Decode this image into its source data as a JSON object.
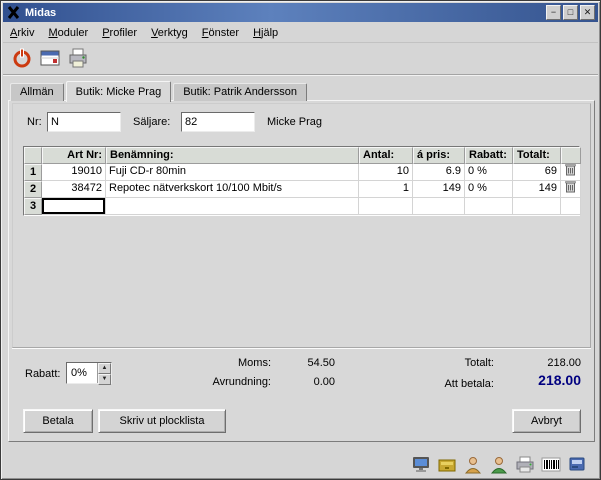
{
  "window": {
    "title": "Midas",
    "controls": {
      "minimize": "−",
      "maximize": "□",
      "close": "✕"
    }
  },
  "menubar": {
    "items": [
      {
        "label": "Arkiv"
      },
      {
        "label": "Moduler"
      },
      {
        "label": "Profiler"
      },
      {
        "label": "Verktyg"
      },
      {
        "label": "Fönster"
      },
      {
        "label": "Hjälp"
      }
    ]
  },
  "toolbar": {
    "buttons": [
      {
        "icon": "power-icon"
      },
      {
        "icon": "new-sale-window-icon"
      },
      {
        "icon": "printer-icon"
      }
    ]
  },
  "tabs": [
    {
      "label": "Allmän",
      "active": false
    },
    {
      "label": "Butik: Micke Prag",
      "active": true
    },
    {
      "label": "Butik: Patrik Andersson",
      "active": false
    }
  ],
  "form": {
    "nr_label": "Nr:",
    "nr_value": "N",
    "saljare_label": "Säljare:",
    "saljare_value": "82",
    "seller_name": "Micke Prag"
  },
  "table": {
    "headers": [
      "Art Nr:",
      "Benämning:",
      "Antal:",
      "á pris:",
      "Rabatt:",
      "Totalt:"
    ],
    "rows": [
      {
        "num": "1",
        "art": "19010",
        "name": "Fuji CD-r 80min",
        "qty": "10",
        "price": "6.9",
        "discount": "0 %",
        "total": "69"
      },
      {
        "num": "2",
        "art": "38472",
        "name": "Repotec nätverkskort 10/100 Mbit/s",
        "qty": "1",
        "price": "149",
        "discount": "0 %",
        "total": "149"
      },
      {
        "num": "3",
        "art": "",
        "name": "",
        "qty": "",
        "price": "",
        "discount": "",
        "total": ""
      }
    ]
  },
  "totals": {
    "rabatt_label": "Rabatt:",
    "rabatt_value": "0%",
    "moms_label": "Moms:",
    "moms_value": "54.50",
    "avrundning_label": "Avrundning:",
    "avrundning_value": "0.00",
    "totalt_label": "Totalt:",
    "totalt_value": "218.00",
    "att_betala_label": "Att betala:",
    "att_betala_value": "218.00"
  },
  "buttons": {
    "betala": "Betala",
    "skriv_ut": "Skriv ut plocklista",
    "avbryt": "Avbryt"
  },
  "tray": {
    "icons": [
      {
        "name": "customer-display-icon"
      },
      {
        "name": "cash-drawer-icon"
      },
      {
        "name": "customer-icon"
      },
      {
        "name": "clerk-icon"
      },
      {
        "name": "receipt-printer-icon"
      },
      {
        "name": "barcode-scanner-icon"
      },
      {
        "name": "card-terminal-icon"
      }
    ]
  },
  "colors": {
    "titlebar_blue": "#31508f",
    "att_betala_color": "#000080",
    "header_bg": "#d8dcd6"
  }
}
